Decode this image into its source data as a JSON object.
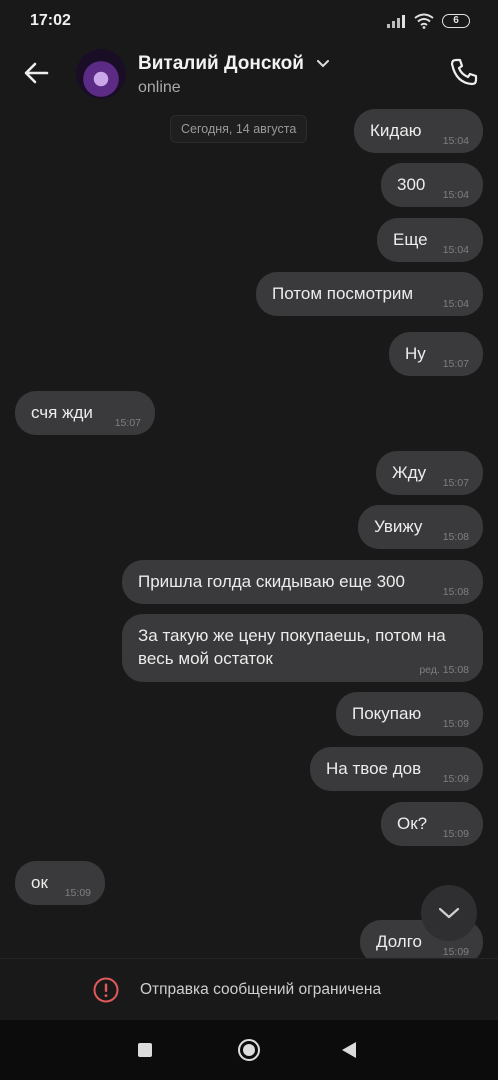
{
  "status_bar": {
    "time": "17:02",
    "battery": "6"
  },
  "header": {
    "contact_name": "Виталий Донской",
    "contact_status": "online"
  },
  "date_separator": "Сегодня, 14 августа",
  "messages": [
    {
      "text": "Кидаю",
      "time": "15:04",
      "side": "out"
    },
    {
      "text": "300",
      "time": "15:04",
      "side": "out"
    },
    {
      "text": "Еще",
      "time": "15:04",
      "side": "out"
    },
    {
      "text": "Потом посмотрим",
      "time": "15:04",
      "side": "out"
    },
    {
      "text": "Ну",
      "time": "15:07",
      "side": "out"
    },
    {
      "text": "счя жди",
      "time": "15:07",
      "side": "in"
    },
    {
      "text": "Жду",
      "time": "15:07",
      "side": "out"
    },
    {
      "text": "Увижу",
      "time": "15:08",
      "side": "out"
    },
    {
      "text": "Пришла голда скидываю еще 300",
      "time": "15:08",
      "side": "out"
    },
    {
      "text": "За такую же цену покупаешь, потом на весь мой остаток",
      "time": "ред. 15:08",
      "side": "out"
    },
    {
      "text": "Покупаю",
      "time": "15:09",
      "side": "out"
    },
    {
      "text": "На твое дов",
      "time": "15:09",
      "side": "out"
    },
    {
      "text": "Ок?",
      "time": "15:09",
      "side": "out"
    },
    {
      "text": "ок",
      "time": "15:09",
      "side": "in"
    },
    {
      "text": "Долго",
      "time": "15:09",
      "side": "out"
    }
  ],
  "restriction": {
    "text": "Отправка сообщений ограничена"
  },
  "icons": {
    "back": "arrow-left-icon",
    "call": "phone-icon",
    "scroll_down": "chevron-down-icon",
    "warning": "exclamation-circle-icon"
  },
  "colors": {
    "background": "#19191a",
    "bubble": "#3a3a3c",
    "warning": "#e05a5a"
  }
}
